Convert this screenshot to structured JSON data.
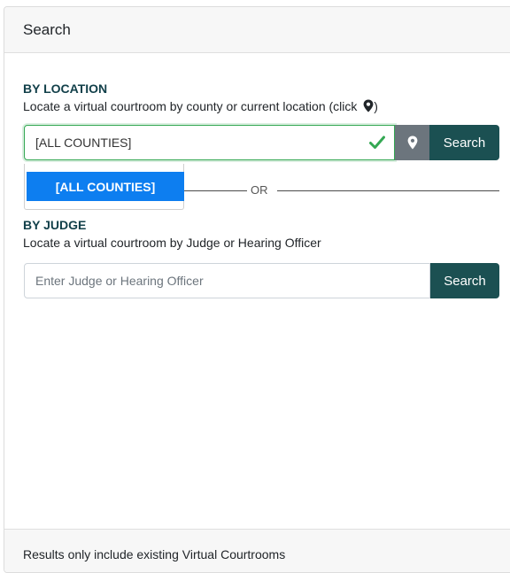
{
  "panel": {
    "title": "Search"
  },
  "location": {
    "label": "BY LOCATION",
    "description": "Locate a virtual courtroom by county or current location (click ",
    "description_end": ")",
    "input_value": "[ALL COUNTIES]",
    "search_label": "Search",
    "dropdown_options": [
      "[ALL COUNTIES]"
    ]
  },
  "divider": {
    "label": "OR"
  },
  "judge": {
    "label": "BY JUDGE",
    "description": "Locate a virtual courtroom by Judge or Hearing Officer",
    "input_placeholder": "Enter Judge or Hearing Officer",
    "search_label": "Search"
  },
  "footer": {
    "note": "Results only include existing Virtual Courtrooms"
  },
  "colors": {
    "primary_button": "#1b5052",
    "location_button": "#6c757d",
    "dropdown_highlight": "#0d7ef0",
    "valid_border": "#34a853"
  }
}
